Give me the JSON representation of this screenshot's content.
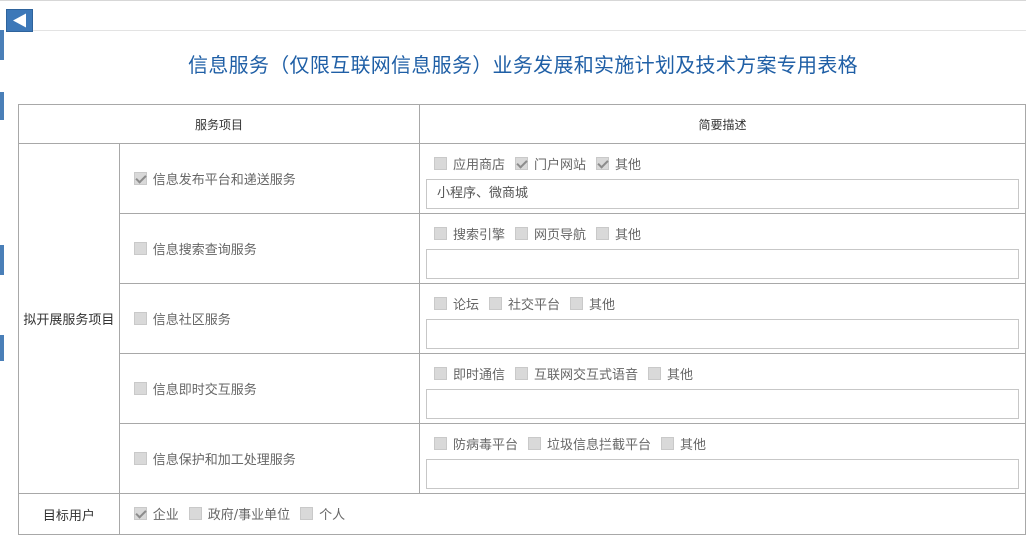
{
  "page": {
    "title": "信息服务（仅限互联网信息服务）业务发展和实施计划及技术方案专用表格"
  },
  "table": {
    "header": {
      "col1": "服务项目",
      "col2": "简要描述"
    },
    "group_label": "拟开展服务项目",
    "services": [
      {
        "label": "信息发布平台和递送服务",
        "checked": true,
        "options": [
          {
            "label": "应用商店",
            "checked": false
          },
          {
            "label": "门户网站",
            "checked": true
          },
          {
            "label": "其他",
            "checked": true
          }
        ],
        "input_value": "小程序、微商城"
      },
      {
        "label": "信息搜索查询服务",
        "checked": false,
        "options": [
          {
            "label": "搜索引擎",
            "checked": false
          },
          {
            "label": "网页导航",
            "checked": false
          },
          {
            "label": "其他",
            "checked": false
          }
        ],
        "input_value": ""
      },
      {
        "label": "信息社区服务",
        "checked": false,
        "options": [
          {
            "label": "论坛",
            "checked": false
          },
          {
            "label": "社交平台",
            "checked": false
          },
          {
            "label": "其他",
            "checked": false
          }
        ],
        "input_value": ""
      },
      {
        "label": "信息即时交互服务",
        "checked": false,
        "options": [
          {
            "label": "即时通信",
            "checked": false
          },
          {
            "label": "互联网交互式语音",
            "checked": false
          },
          {
            "label": "其他",
            "checked": false
          }
        ],
        "input_value": ""
      },
      {
        "label": "信息保护和加工处理服务",
        "checked": false,
        "options": [
          {
            "label": "防病毒平台",
            "checked": false
          },
          {
            "label": "垃圾信息拦截平台",
            "checked": false
          },
          {
            "label": "其他",
            "checked": false
          }
        ],
        "input_value": ""
      }
    ],
    "target_users": {
      "label": "目标用户",
      "options": [
        {
          "label": "企业",
          "checked": true
        },
        {
          "label": "政府/事业单位",
          "checked": false
        },
        {
          "label": "个人",
          "checked": false
        }
      ]
    }
  },
  "colors": {
    "title": "#1f5fa6",
    "back_button": "#3d78b8",
    "border": "#a8a8a8"
  },
  "icons": {
    "back": "triangle-left-icon"
  }
}
